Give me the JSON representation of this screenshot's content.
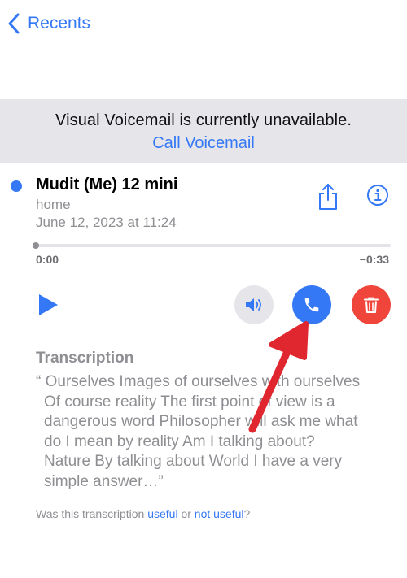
{
  "nav": {
    "back_label": "Recents"
  },
  "banner": {
    "message": "Visual Voicemail is currently unavailable.",
    "action_label": "Call Voicemail"
  },
  "voicemail": {
    "caller": "Mudit (Me) 12 mini",
    "label": "home",
    "date": "June 12, 2023 at 11:24",
    "elapsed": "0:00",
    "remaining": "−0:33",
    "progress": 0.0
  },
  "controls": {
    "icons": [
      "play-icon",
      "speaker-icon",
      "phone-icon",
      "trash-icon",
      "share-icon",
      "info-icon"
    ]
  },
  "transcription": {
    "title": "Transcription",
    "lines": [
      "“ Ourselves Images of ourselves with ourselves",
      "Of course reality The first point of view is a",
      "dangerous word Philosopher will ask me what",
      "do I mean by reality Am I talking about?",
      "Nature By talking about World I have a very",
      "simple answer…”"
    ]
  },
  "feedback": {
    "prefix": "Was this transcription ",
    "useful": "useful",
    "middle": " or ",
    "not_useful": "not useful",
    "suffix": "?"
  },
  "colors": {
    "accent": "#3478f6",
    "banner_bg": "#e5e5ea",
    "delete": "#f0453a",
    "secondary_text": "#8e8e93",
    "annotation_arrow": "#e0262e"
  }
}
